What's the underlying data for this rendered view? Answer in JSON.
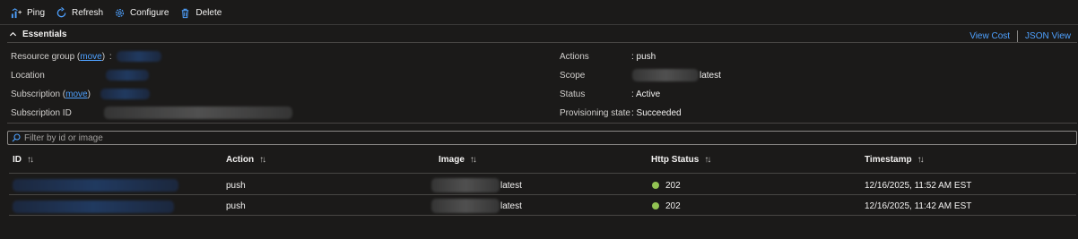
{
  "toolbar": {
    "ping": "Ping",
    "refresh": "Refresh",
    "configure": "Configure",
    "delete": "Delete"
  },
  "essentials": {
    "title": "Essentials",
    "view_cost": "View Cost",
    "json_view": "JSON View",
    "left": {
      "resource_group_label": "Resource group",
      "move_link": "move",
      "location_label": "Location",
      "subscription_label": "Subscription",
      "subscription_id_label": "Subscription ID"
    },
    "right": {
      "actions_label": "Actions",
      "actions_value": ": push",
      "scope_label": "Scope",
      "scope_suffix": "latest",
      "status_label": "Status",
      "status_value": ": Active",
      "provisioning_label": "Provisioning state",
      "provisioning_value": ": Succeeded"
    }
  },
  "filter": {
    "placeholder": "Filter by id or image"
  },
  "table": {
    "columns": [
      "ID",
      "Action",
      "Image",
      "Http Status",
      "Timestamp"
    ],
    "rows": [
      {
        "action": "push",
        "image_suffix": "latest",
        "status": "202",
        "timestamp": "12/16/2025, 11:52 AM EST"
      },
      {
        "action": "push",
        "image_suffix": "latest",
        "status": "202",
        "timestamp": "12/16/2025, 11:42 AM EST"
      }
    ]
  },
  "colors": {
    "link": "#4ea1ff",
    "status_ok": "#92c353",
    "background": "#1b1a19"
  }
}
